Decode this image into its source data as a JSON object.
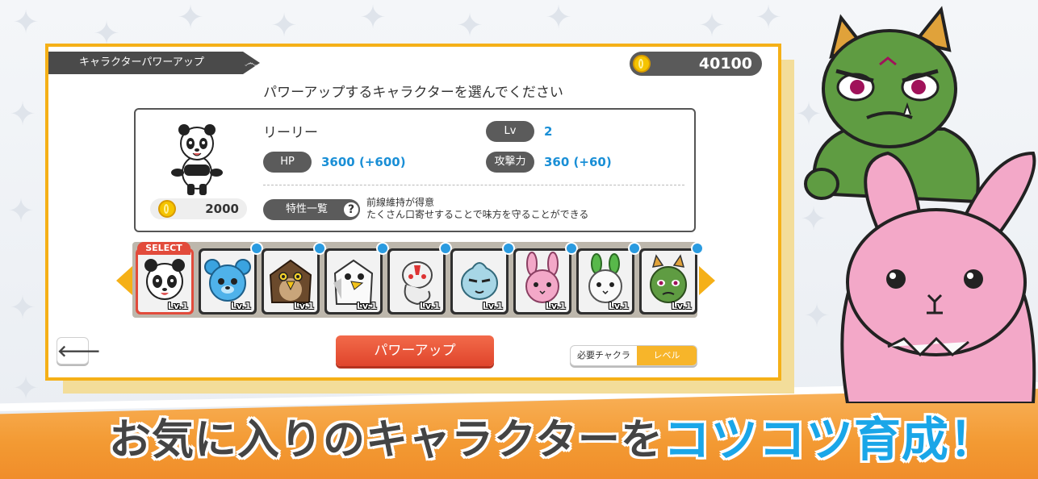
{
  "header": {
    "title": "キャラクターパワーアップ",
    "coins": "40100"
  },
  "prompt": "パワーアップするキャラクターを選んでください",
  "character": {
    "name": "リーリー",
    "lv_label": "Lv",
    "lv_value": "2",
    "hp_label": "HP",
    "hp_value": "3600 (+600)",
    "atk_label": "攻撃力",
    "atk_value": "360 (+60)",
    "cost": "2000",
    "trait_label": "特性一覧",
    "trait_help": "?",
    "trait_line1": "前線維持が得意",
    "trait_line2": "たくさん口寄せすることで味方を守ることができる"
  },
  "roster": {
    "select_label": "SELECT",
    "slots": [
      {
        "lv": "Lv.1",
        "icon": "panda-icon"
      },
      {
        "lv": "Lv.1",
        "icon": "blue-bear-icon"
      },
      {
        "lv": "Lv.1",
        "icon": "hawk-icon"
      },
      {
        "lv": "Lv.1",
        "icon": "white-eagle-icon"
      },
      {
        "lv": "Lv.1",
        "icon": "white-snake-icon"
      },
      {
        "lv": "Lv.1",
        "icon": "blue-creature-icon"
      },
      {
        "lv": "Lv.1",
        "icon": "pink-rabbit-icon"
      },
      {
        "lv": "Lv.1",
        "icon": "leaf-rabbit-icon"
      },
      {
        "lv": "Lv.1",
        "icon": "green-oni-icon"
      }
    ]
  },
  "buttons": {
    "back": "🡐",
    "power_up": "パワーアップ",
    "sort_a": "必要チャクラ",
    "sort_b": "レベル"
  },
  "tagline": {
    "part1": "お気に入りのキャラクターを",
    "part2": "コツコツ育成！"
  },
  "colors": {
    "accent_orange": "#f5b017",
    "stat_blue": "#1a8fd6",
    "button_red": "#e24b3b",
    "tagline_blue": "#1aa6e8"
  }
}
